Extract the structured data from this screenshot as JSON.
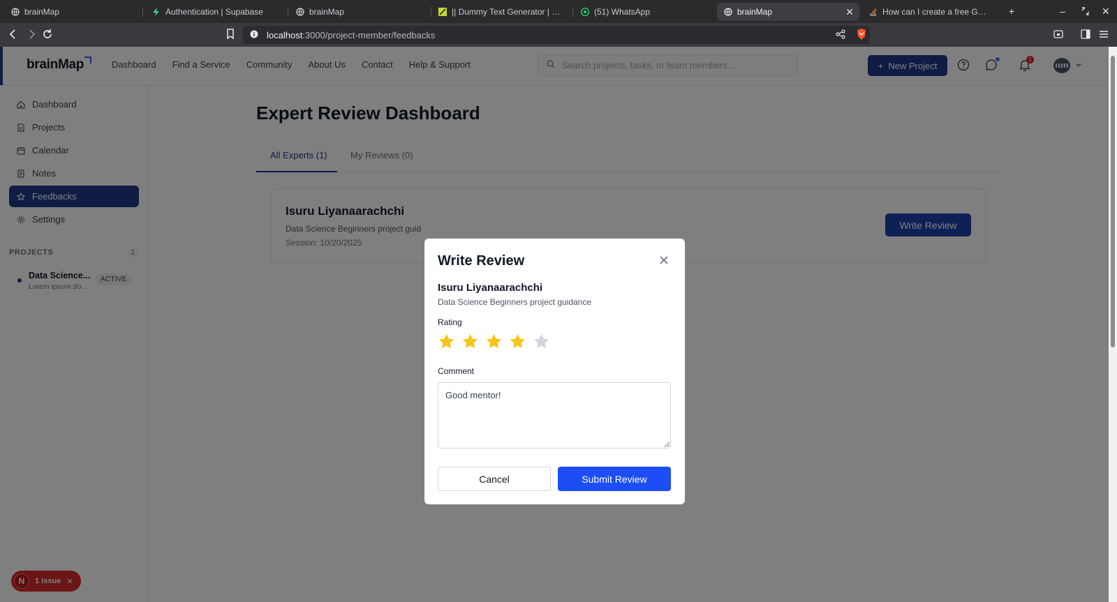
{
  "browser": {
    "tabs": [
      {
        "label": "brainMap",
        "icon": "globe-icon"
      },
      {
        "label": "Authentication | Supabase",
        "icon": "supabase-icon"
      },
      {
        "label": "brainMap",
        "icon": "globe-icon"
      },
      {
        "label": "|| Dummy Text Generator | Lorem",
        "icon": "lorem-icon"
      },
      {
        "label": "(51) WhatsApp",
        "icon": "whatsapp-icon"
      },
      {
        "label": "brainMap",
        "icon": "globe-icon",
        "active": true
      },
      {
        "label": "How can I create a free Google",
        "icon": "stackoverflow-icon"
      }
    ],
    "url_host": "localhost",
    "url_path": ":3000/project-member/feedbacks"
  },
  "header": {
    "logo": "brainMap",
    "nav": [
      "Dashboard",
      "Find a Service",
      "Community",
      "About Us",
      "Contact",
      "Help & Support"
    ],
    "search_placeholder": "Search projects, tasks, or team members...",
    "new_project_label": "New Project",
    "notification_count": "1"
  },
  "sidebar": {
    "items": [
      {
        "label": "Dashboard",
        "icon": "home-icon"
      },
      {
        "label": "Projects",
        "icon": "document-icon"
      },
      {
        "label": "Calendar",
        "icon": "calendar-icon"
      },
      {
        "label": "Notes",
        "icon": "notes-icon"
      },
      {
        "label": "Feedbacks",
        "icon": "star-icon",
        "active": true
      },
      {
        "label": "Settings",
        "icon": "gear-icon"
      }
    ],
    "projects_heading": "PROJECTS",
    "projects_count": "1",
    "projects": [
      {
        "name": "Data Science...",
        "desc": "Lorem ipsum do...",
        "status": "ACTIVE"
      }
    ]
  },
  "main": {
    "title": "Expert Review Dashboard",
    "tabs": [
      {
        "label": "All Experts (1)",
        "active": true
      },
      {
        "label": "My Reviews (0)"
      }
    ],
    "expert": {
      "name": "Isuru Liyanaarachchi",
      "desc": "Data Science Beginners project guid",
      "session": "Session: 10/20/2025",
      "button": "Write Review"
    }
  },
  "issue": {
    "letter": "N",
    "label": "1 Issue"
  },
  "modal": {
    "title": "Write Review",
    "name": "Isuru Liyanaarachchi",
    "desc": "Data Science Beginners project guidance",
    "rating_label": "Rating",
    "rating": 4,
    "rating_max": 5,
    "comment_label": "Comment",
    "comment": "Good mentor!",
    "cancel": "Cancel",
    "submit": "Submit Review"
  },
  "colors": {
    "brand": "#1e3a8a",
    "submit": "#1d4ef5",
    "star_on": "#f5c518",
    "star_off": "#d1d5db",
    "issue": "#d62a2a"
  }
}
